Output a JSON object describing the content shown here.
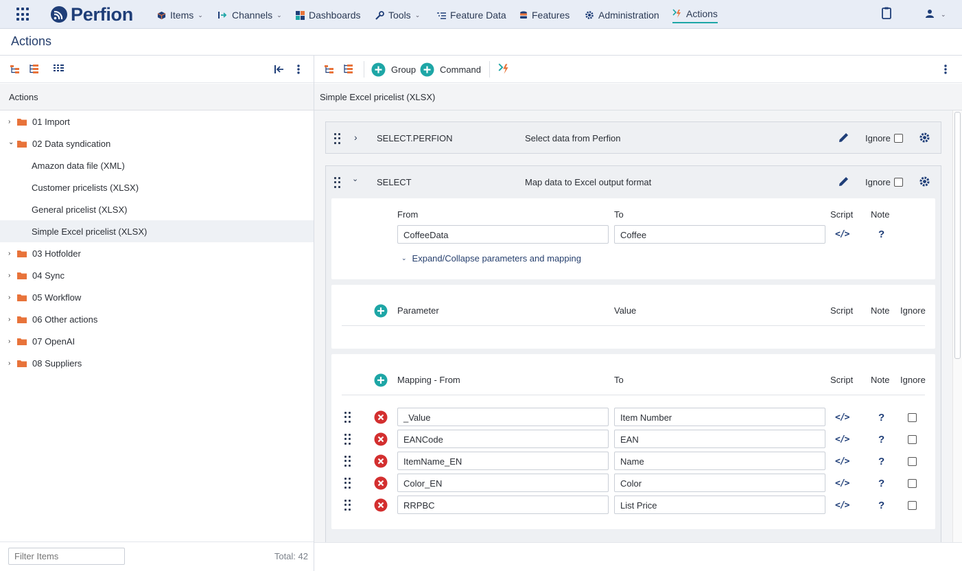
{
  "nav": {
    "logo_text": "Perfion",
    "items": [
      {
        "label": "Items"
      },
      {
        "label": "Channels"
      },
      {
        "label": "Dashboards"
      },
      {
        "label": "Tools"
      },
      {
        "label": "Feature Data"
      },
      {
        "label": "Features"
      },
      {
        "label": "Administration"
      },
      {
        "label": "Actions"
      }
    ],
    "active": "Actions"
  },
  "page": {
    "title": "Actions"
  },
  "left": {
    "header": "Actions",
    "tree": [
      {
        "label": "01 Import",
        "type": "folder",
        "expanded": false
      },
      {
        "label": "02 Data syndication",
        "type": "folder",
        "expanded": true
      },
      {
        "label": "Amazon data file (XML)",
        "type": "action"
      },
      {
        "label": "Customer pricelists (XLSX)",
        "type": "action"
      },
      {
        "label": "General pricelist (XLSX)",
        "type": "action"
      },
      {
        "label": "Simple Excel pricelist (XLSX)",
        "type": "action",
        "selected": true
      },
      {
        "label": "03 Hotfolder",
        "type": "folder",
        "expanded": false
      },
      {
        "label": "04 Sync",
        "type": "folder",
        "expanded": false
      },
      {
        "label": "05 Workflow",
        "type": "folder",
        "expanded": false
      },
      {
        "label": "06 Other actions",
        "type": "folder",
        "expanded": false
      },
      {
        "label": "07 OpenAI",
        "type": "folder",
        "expanded": false
      },
      {
        "label": "08 Suppliers",
        "type": "folder",
        "expanded": false
      }
    ],
    "filter_placeholder": "Filter Items",
    "total": "Total: 42"
  },
  "right": {
    "toolbar": {
      "group_label": "Group",
      "command_label": "Command"
    },
    "header": "Simple Excel pricelist (XLSX)",
    "commands": [
      {
        "name": "SELECT.PERFION",
        "description": "Select data from Perfion",
        "ignore_label": "Ignore",
        "expanded": false
      },
      {
        "name": "SELECT",
        "description": "Map data to Excel output format",
        "ignore_label": "Ignore",
        "expanded": true
      }
    ],
    "select": {
      "from_label": "From",
      "to_label": "To",
      "script_label": "Script",
      "note_label": "Note",
      "from_value": "CoffeeData",
      "to_value": "Coffee",
      "expand_label": "Expand/Collapse parameters and mapping",
      "params": {
        "col_param": "Parameter",
        "col_value": "Value",
        "col_script": "Script",
        "col_note": "Note",
        "col_ignore": "Ignore"
      },
      "mapping": {
        "col_from": "Mapping - From",
        "col_to": "To",
        "col_script": "Script",
        "col_note": "Note",
        "col_ignore": "Ignore",
        "rows": [
          {
            "from": "_Value",
            "to": "Item Number"
          },
          {
            "from": "EANCode",
            "to": "EAN"
          },
          {
            "from": "ItemName_EN",
            "to": "Name"
          },
          {
            "from": "Color_EN",
            "to": "Color"
          },
          {
            "from": "RRPBC",
            "to": "List Price"
          }
        ]
      }
    }
  },
  "colors": {
    "accent_teal": "#1ea6a6",
    "brand_navy": "#1f3e78",
    "folder_orange": "#e8733a",
    "remove_red": "#d32f2f"
  }
}
